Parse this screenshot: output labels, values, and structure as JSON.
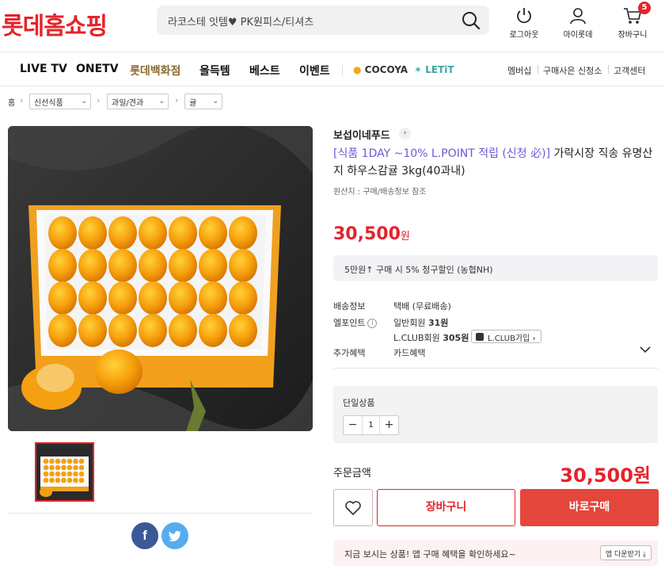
{
  "header": {
    "logo": "롯데홈쇼핑",
    "search_text": "라코스테 잇템♥ PK원피스/티셔츠",
    "logout_label": "로그아웃",
    "mypage_label": "마이롯데",
    "cart_label": "장바구니",
    "cart_count": "5"
  },
  "nav": {
    "items": [
      "LIVE TV",
      "ONETV",
      "롯데백화점",
      "올득템",
      "베스트",
      "이벤트"
    ],
    "cocoya": "COCOYA",
    "letit": "LETiT",
    "util": [
      "멤버십",
      "구매사은 신청소",
      "고객센터"
    ]
  },
  "breadcrumb": {
    "home": "홈",
    "levels": [
      "신선식품",
      "과일/견과",
      "귤"
    ]
  },
  "product": {
    "brand": "보섭이네푸드",
    "title_promo": "[식품 1DAY ~10% L.POINT 적립 (신청 必)]",
    "title_rest": " 가락시장 직송 유명산지 하우스감귤 3kg(40과내)",
    "origin": "원산지 : 구매/배송정보 참조",
    "price": "30,500",
    "price_unit": "원",
    "promo_text": "5만원↑ 구매 시 5% 청구할인 (농협NH)"
  },
  "info": {
    "shipping_label": "배송정보",
    "shipping_value": "택배 (무료배송)",
    "point_label": "엘포인트",
    "point_general": "일반회원",
    "point_general_value": "31원",
    "point_lclub": "L.CLUB회원",
    "point_lclub_value": "305원",
    "lclub_button": "L.CLUB가입",
    "benefit_label": "추가혜택",
    "benefit_value": "카드혜택"
  },
  "option": {
    "label": "단일상품",
    "quantity": "1"
  },
  "order": {
    "total_label": "주문금액",
    "total_price": "30,500원",
    "cart_button": "장바구니",
    "buy_button": "바로구매"
  },
  "app_banner": {
    "text": "지금 보시는 상품! 앱 구매 혜택을 확인하세요~",
    "button": "앱 다운받기"
  },
  "colors": {
    "brand_red": "#e5232b",
    "promo_purple": "#6b5bd6"
  }
}
